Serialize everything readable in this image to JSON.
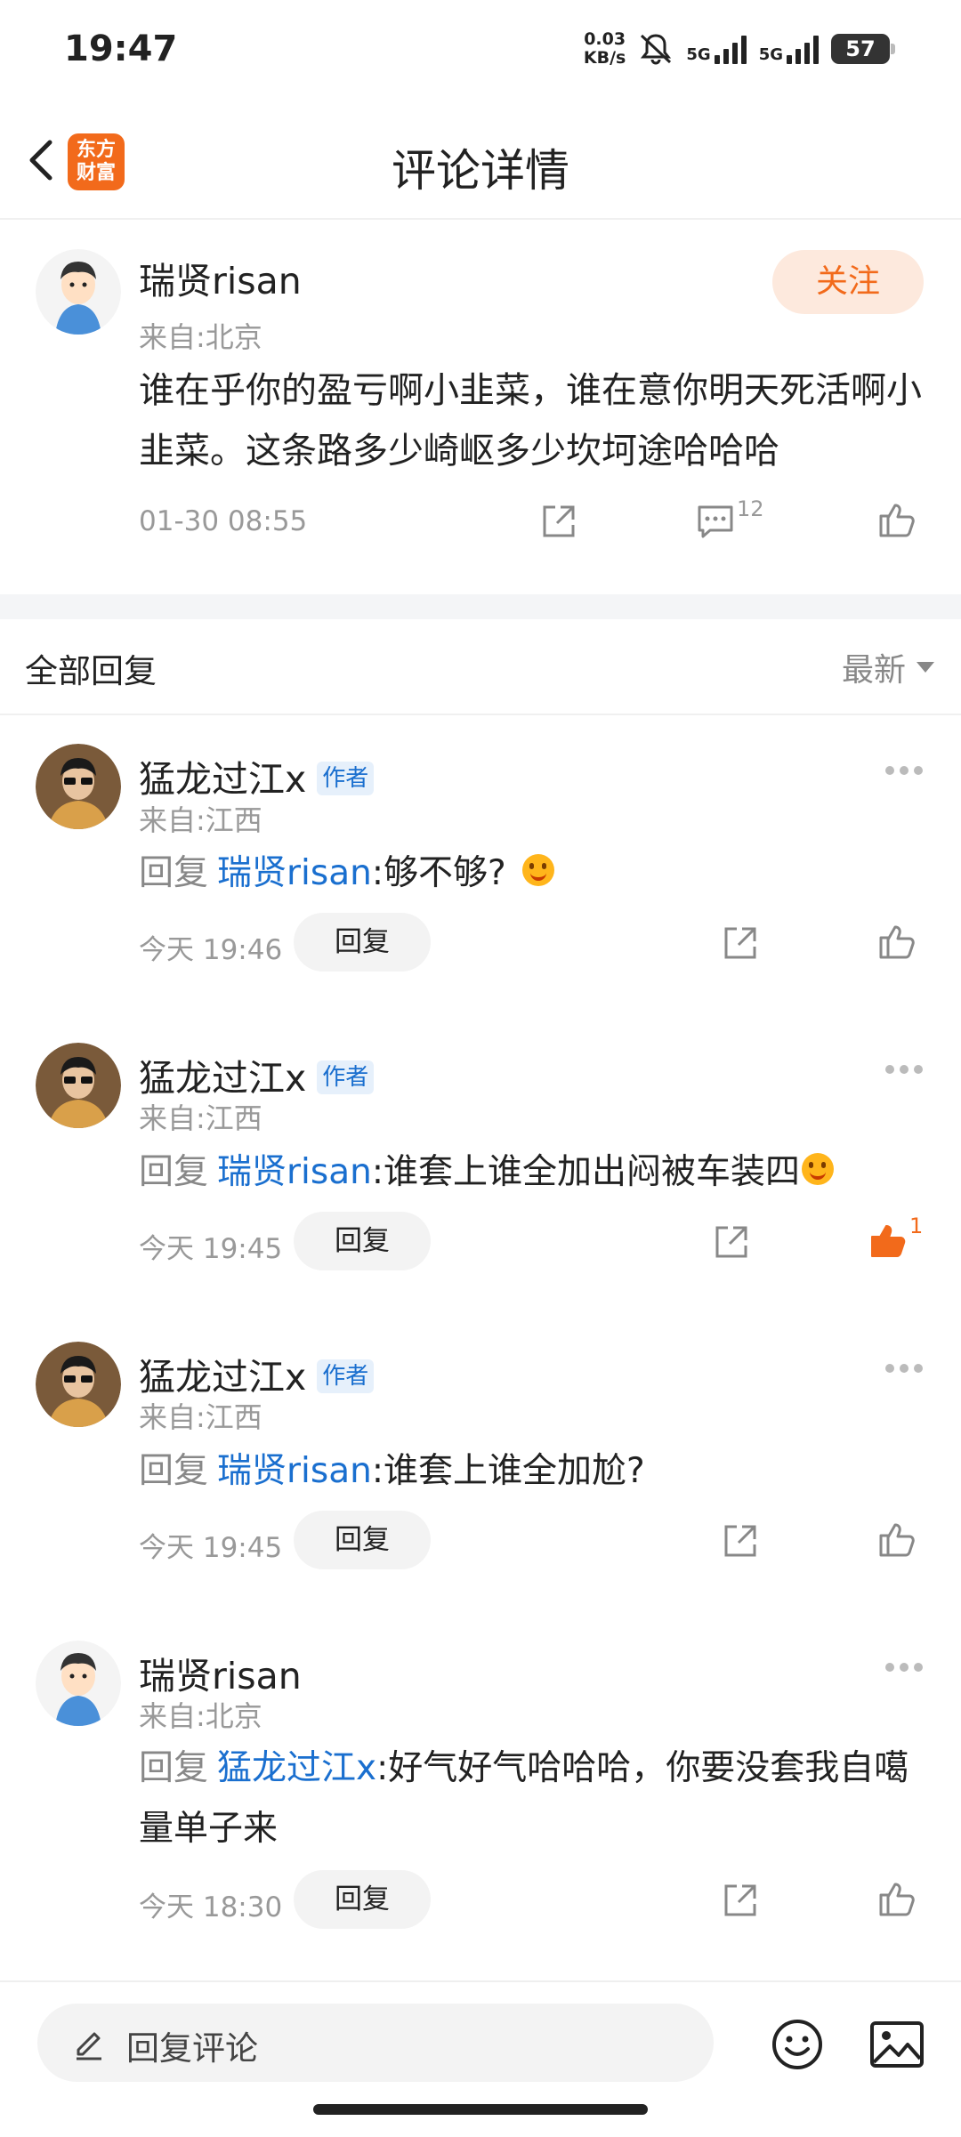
{
  "status_bar": {
    "time": "19:47",
    "net_speed_value": "0.03",
    "net_speed_unit": "KB/s",
    "sim1_label": "5G",
    "sim2_label": "5G",
    "battery": "57"
  },
  "header": {
    "logo_line1": "东方",
    "logo_line2": "财富",
    "title": "评论详情"
  },
  "post": {
    "username": "瑞贤risan",
    "location": "来自:北京",
    "follow_label": "关注",
    "text": "谁在乎你的盈亏啊小韭菜，谁在意你明天死活啊小韭菜。这条路多少崎岖多少坎坷途哈哈哈",
    "time": "01-30 08:55",
    "comment_count": "12"
  },
  "replies_section": {
    "title": "全部回复",
    "sort_label": "最新"
  },
  "replies": [
    {
      "username": "猛龙过江x",
      "badge": "作者",
      "location": "来自:江西",
      "prefix": "回复",
      "mention": "瑞贤risan",
      "text": ":够不够?",
      "time": "今天 19:46",
      "reply_label": "回复",
      "like_count": ""
    },
    {
      "username": "猛龙过江x",
      "badge": "作者",
      "location": "来自:江西",
      "prefix": "回复",
      "mention": "瑞贤risan",
      "text": ":谁套上谁全加出闷被车装四",
      "time": "今天 19:45",
      "reply_label": "回复",
      "like_count": "1"
    },
    {
      "username": "猛龙过江x",
      "badge": "作者",
      "location": "来自:江西",
      "prefix": "回复",
      "mention": "瑞贤risan",
      "text": ":谁套上谁全加尬?",
      "time": "今天 19:45",
      "reply_label": "回复",
      "like_count": ""
    },
    {
      "username": "瑞贤risan",
      "badge": "",
      "location": "来自:北京",
      "prefix": "回复",
      "mention": "猛龙过江x",
      "text": ":好气好气哈哈哈，你要没套我自噶量单子来",
      "time": "今天 18:30",
      "reply_label": "回复",
      "like_count": ""
    }
  ],
  "bottom_bar": {
    "input_placeholder": "回复评论"
  },
  "colors": {
    "brand": "#f26a1b",
    "mention": "#1a6fcf",
    "muted": "#999999"
  }
}
